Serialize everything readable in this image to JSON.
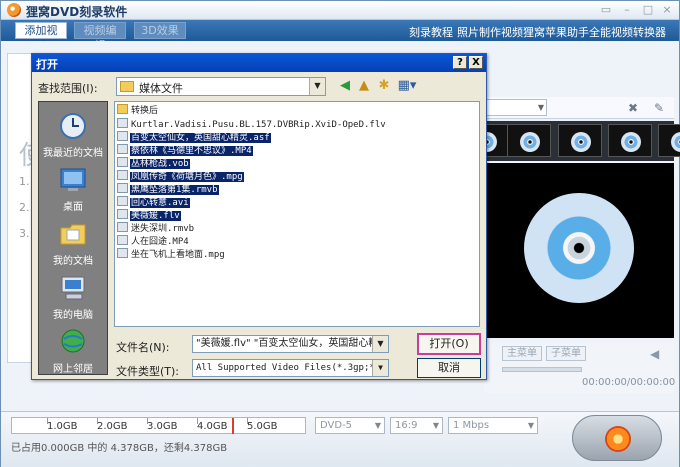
{
  "app": {
    "title": "狸窝DVD刻录软件",
    "tabs": [
      {
        "label": "添加视频",
        "state": "active"
      },
      {
        "label": "视频编辑",
        "state": "disabled"
      },
      {
        "label": "3D效果",
        "state": "disabled"
      }
    ],
    "links": [
      "刻录教程",
      "照片制作视频",
      "狸窝苹果助手",
      "全能视频转换器"
    ]
  },
  "left_panel": {
    "glyph": "使",
    "items": [
      "1.",
      "2.",
      "3."
    ]
  },
  "player": {
    "buttons": [
      "主菜单",
      "子菜单"
    ],
    "time": "00:00:00/00:00:00"
  },
  "bottom": {
    "capacity_ticks": [
      "1.0GB",
      "2.0GB",
      "3.0GB",
      "4.0GB",
      "5.0GB"
    ],
    "status": "已占用0.000GB 中的 4.378GB，还剩4.378GB",
    "disc_type": "DVD-5",
    "aspect": "16:9",
    "bitrate": "1 Mbps"
  },
  "dialog": {
    "title": "打开",
    "help_btn": "?",
    "close_btn": "X",
    "look_in_label": "查找范围(I):",
    "look_in_value": "媒体文件",
    "places": [
      "我最近的文档",
      "桌面",
      "我的文档",
      "我的电脑",
      "网上邻居"
    ],
    "files": [
      {
        "name": "转换后",
        "kind": "folder",
        "selected": false
      },
      {
        "name": "Kurtlar.Vadisi.Pusu.BL.157.DVBRip.XviD-OpeD.flv",
        "kind": "video",
        "selected": false
      },
      {
        "name": "百变太空仙女，英国甜心精灵.asf",
        "kind": "video",
        "selected": true
      },
      {
        "name": "蔡依林《马德里不思议》.MP4",
        "kind": "video",
        "selected": true
      },
      {
        "name": "丛林枪战.vob",
        "kind": "video",
        "selected": true
      },
      {
        "name": "凤凰传奇《荷塘月色》.mpg",
        "kind": "video",
        "selected": true
      },
      {
        "name": "黑鹰坠落第1集.rmvb",
        "kind": "video",
        "selected": true
      },
      {
        "name": "回心转意.avi",
        "kind": "video",
        "selected": true
      },
      {
        "name": "美薇媛.flv",
        "kind": "video",
        "selected": true
      },
      {
        "name": "迷失深圳.rmvb",
        "kind": "video",
        "selected": false
      },
      {
        "name": "人在囧途.MP4",
        "kind": "video",
        "selected": false
      },
      {
        "name": "坐在飞机上看地面.mpg",
        "kind": "video",
        "selected": false
      }
    ],
    "filename_label": "文件名(N):",
    "filename_value": "\"美薇媛.flv\" \"百变太空仙女，英国甜心精",
    "filetype_label": "文件类型(T):",
    "filetype_value": "All Supported Video Files(*.3gp;*.3gp",
    "open_label": "打开(O)",
    "cancel_label": "取消"
  }
}
